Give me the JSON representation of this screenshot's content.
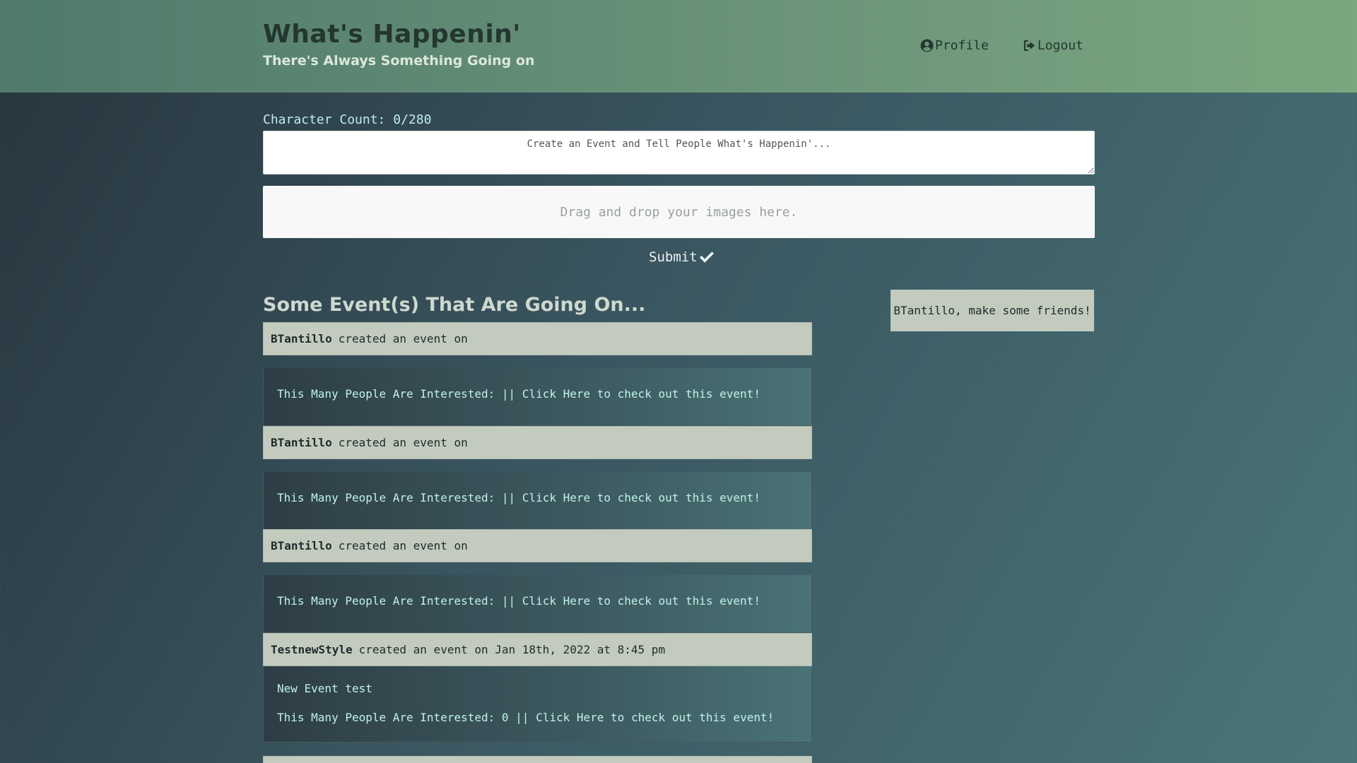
{
  "header": {
    "title": "What's Happenin'",
    "subtitle": "There's Always Something Going on",
    "nav": {
      "profile_label": "Profile",
      "logout_label": "Logout"
    }
  },
  "composer": {
    "char_count": "Character Count: 0/280",
    "placeholder": "Create an Event and Tell People What's Happenin'...",
    "dropzone_text": "Drag and drop your images here.",
    "submit_label": "Submit"
  },
  "feed": {
    "heading": "Some Event(s) That Are Going On...",
    "events": [
      {
        "user": "BTantillo",
        "action": "created an event on",
        "description": "",
        "interested": "This Many People Are Interested:",
        "interested_count": "",
        "separator": "||",
        "link": "Click Here to check out this event!"
      },
      {
        "user": "BTantillo",
        "action": "created an event on",
        "description": "",
        "interested": "This Many People Are Interested:",
        "interested_count": "",
        "separator": "||",
        "link": "Click Here to check out this event!"
      },
      {
        "user": "BTantillo",
        "action": "created an event on",
        "description": "",
        "interested": "This Many People Are Interested:",
        "interested_count": "",
        "separator": "||",
        "link": "Click Here to check out this event!"
      },
      {
        "user": "TestnewStyle",
        "action": "created an event on Jan 18th, 2022 at 8:45 pm",
        "description": "New Event test",
        "interested": "This Many People Are Interested:",
        "interested_count": "0",
        "separator": "||",
        "link": "Click Here to check out this event!"
      }
    ]
  },
  "sidebar": {
    "friends_message": "BTantillo, make some friends!"
  },
  "colors": {
    "header_bg": "#6c9579",
    "card_head_bg": "#c3cbbf",
    "link_text": "#bff2ea"
  },
  "icons": {
    "profile": "user-circle-icon",
    "logout": "sign-out-icon",
    "submit": "check-icon"
  }
}
